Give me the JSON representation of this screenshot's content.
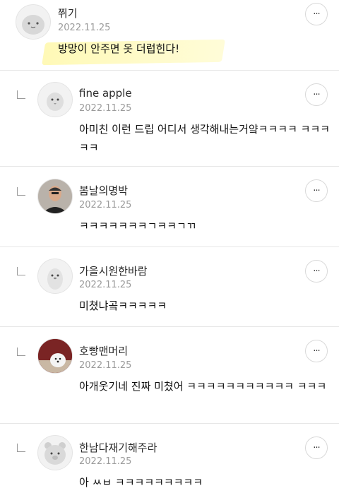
{
  "comments": [
    {
      "name": "쮜기",
      "date": "2022.11.25",
      "text": "방망이 안주면 옷 더럽힌다!",
      "avatar": "bunny-avatar-icon",
      "reply": false
    },
    {
      "name": "fine apple",
      "date": "2022.11.25",
      "text": "아미친 이런 드립 어디서 생각해내는거얔ㅋㅋㅋㅋ ㅋㅋㅋㅋㅋ",
      "avatar": "chick-avatar-icon",
      "reply": true
    },
    {
      "name": "봄날의명박",
      "date": "2022.11.25",
      "text": "ㅋㅋㅋㅋㅋㅋㅋㄱㅋㅋㄱㄲ",
      "avatar": "man-photo-avatar",
      "reply": true
    },
    {
      "name": "가을시원한바람",
      "date": "2022.11.25",
      "text": "미쳤냐곸ㅋㅋㅋㅋㅋ",
      "avatar": "penguin-avatar-icon",
      "reply": true
    },
    {
      "name": "호빵맨머리",
      "date": "2022.11.25",
      "text": "아개웃기네 진짜 미쳤어 ㅋㅋㅋㅋㅋㅋㅋㅋㅋㅋㅋ ㅋㅋㅋ",
      "avatar": "dog-photo-avatar",
      "reply": true
    },
    {
      "name": "한남다재기해주라",
      "date": "2022.11.25",
      "text": "아 ㅆㅂ ㅋㅋㅋㅋㅋㅋㅋㅋㅋ",
      "avatar": "bear-avatar-icon",
      "reply": true
    }
  ],
  "more_label": "···"
}
